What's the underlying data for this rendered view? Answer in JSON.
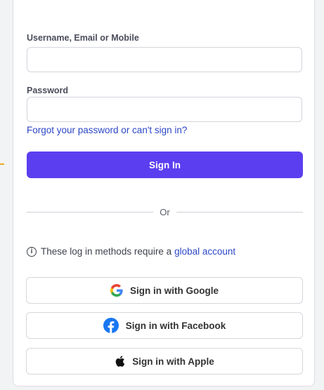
{
  "form": {
    "username_label": "Username, Email or Mobile",
    "username_value": "",
    "password_label": "Password",
    "password_value": "",
    "forgot_link": "Forgot your password or can't sign in?",
    "signin_label": "Sign In",
    "divider_text": "Or"
  },
  "notice": {
    "text": "These log in methods require a",
    "link": "global account",
    "icon": "info-icon"
  },
  "social": [
    {
      "label": "Sign in with Google",
      "icon": "google-icon"
    },
    {
      "label": "Sign in with Facebook",
      "icon": "facebook-icon"
    },
    {
      "label": "Sign in with Apple",
      "icon": "apple-icon"
    }
  ],
  "colors": {
    "accent": "#5b3ef0",
    "link": "#2c47c4",
    "facebook": "#1877f2"
  }
}
